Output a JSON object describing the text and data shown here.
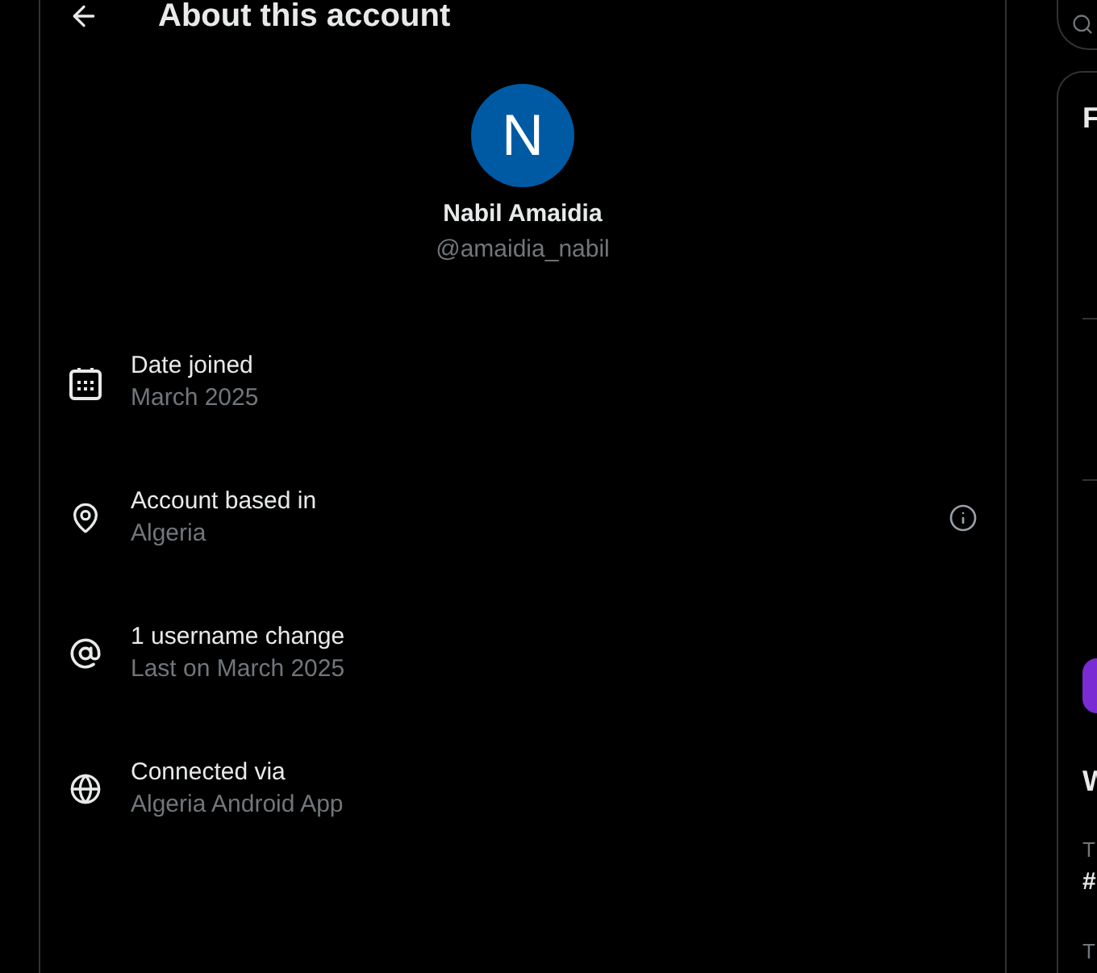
{
  "header": {
    "title": "About this account"
  },
  "profile": {
    "initial": "N",
    "name": "Nabil Amaidia",
    "handle": "@amaidia_nabil"
  },
  "details": [
    {
      "kind": "calendar",
      "label": "Date joined",
      "value": "March 2025",
      "has_info": false
    },
    {
      "kind": "location",
      "label": "Account based in",
      "value": "Algeria",
      "has_info": true
    },
    {
      "kind": "mention",
      "label": "1 username change",
      "value": "Last on March 2025",
      "has_info": false
    },
    {
      "kind": "globe",
      "label": "Connected via",
      "value": "Algeria Android App",
      "has_info": false
    }
  ],
  "sidebar": {
    "top_card": {
      "heading": "F"
    },
    "lower_card": {
      "heading": "W",
      "trends": [
        {
          "category": "T",
          "title": "#"
        },
        {
          "category": "T"
        }
      ]
    }
  }
}
